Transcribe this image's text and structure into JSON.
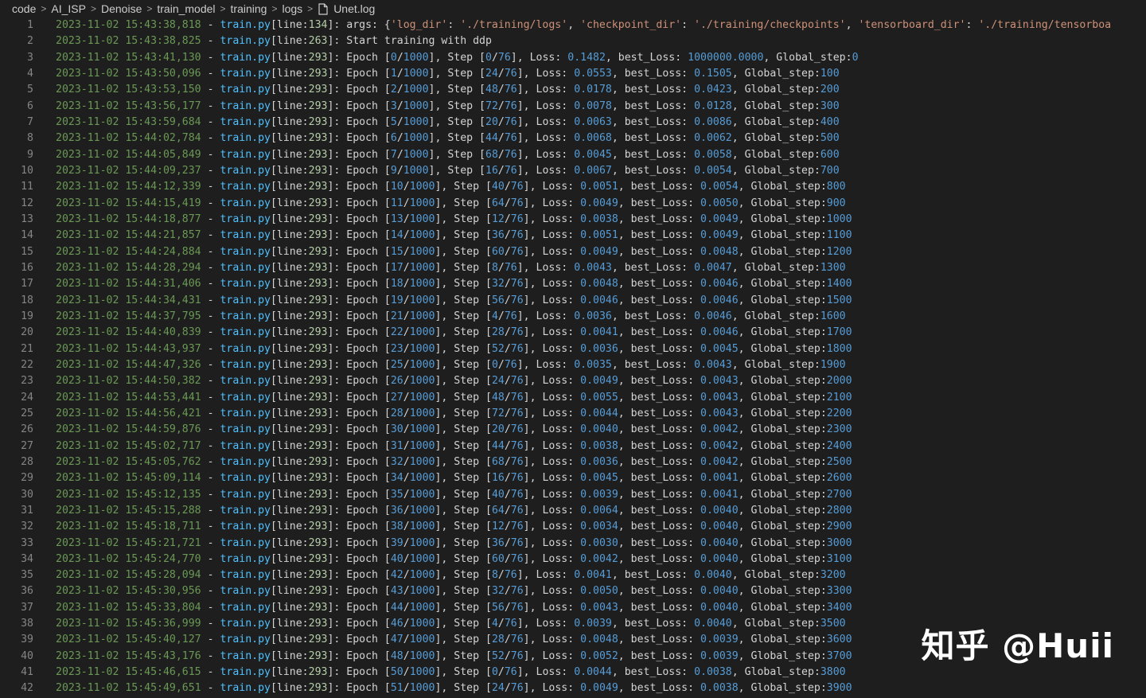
{
  "breadcrumb": [
    "code",
    "AI_ISP",
    "Denoise",
    "train_model",
    "training",
    "logs"
  ],
  "file_name": "Unet.log",
  "watermark": "知乎 @Huii",
  "colors": {
    "timestamp": "#6a9955",
    "file": "#4fc1ff",
    "number": "#569cd6",
    "string": "#ce9178"
  },
  "log": {
    "line1": {
      "ts": "2023-11-02 15:43:38,818",
      "file": "train.py",
      "src_line": "134",
      "args": [
        {
          "key": "'log_dir'",
          "val": "'./training/logs'"
        },
        {
          "key": "'checkpoint_dir'",
          "val": "'./training/checkpoints'"
        },
        {
          "key": "'tensorboard_dir'",
          "val": "'./training/tensorboa"
        }
      ]
    },
    "line2": {
      "ts": "2023-11-02 15:43:38,825",
      "file": "train.py",
      "src_line": "263",
      "message": "Start training with ddp"
    },
    "entries": [
      [
        "2023-11-02 15:43:41,130",
        "0",
        "1000",
        "0",
        "76",
        "0.1482",
        "1000000.0000",
        "0"
      ],
      [
        "2023-11-02 15:43:50,096",
        "1",
        "1000",
        "24",
        "76",
        "0.0553",
        "0.1505",
        "100"
      ],
      [
        "2023-11-02 15:43:53,150",
        "2",
        "1000",
        "48",
        "76",
        "0.0178",
        "0.0423",
        "200"
      ],
      [
        "2023-11-02 15:43:56,177",
        "3",
        "1000",
        "72",
        "76",
        "0.0078",
        "0.0128",
        "300"
      ],
      [
        "2023-11-02 15:43:59,684",
        "5",
        "1000",
        "20",
        "76",
        "0.0063",
        "0.0086",
        "400"
      ],
      [
        "2023-11-02 15:44:02,784",
        "6",
        "1000",
        "44",
        "76",
        "0.0068",
        "0.0062",
        "500"
      ],
      [
        "2023-11-02 15:44:05,849",
        "7",
        "1000",
        "68",
        "76",
        "0.0045",
        "0.0058",
        "600"
      ],
      [
        "2023-11-02 15:44:09,237",
        "9",
        "1000",
        "16",
        "76",
        "0.0067",
        "0.0054",
        "700"
      ],
      [
        "2023-11-02 15:44:12,339",
        "10",
        "1000",
        "40",
        "76",
        "0.0051",
        "0.0054",
        "800"
      ],
      [
        "2023-11-02 15:44:15,419",
        "11",
        "1000",
        "64",
        "76",
        "0.0049",
        "0.0050",
        "900"
      ],
      [
        "2023-11-02 15:44:18,877",
        "13",
        "1000",
        "12",
        "76",
        "0.0038",
        "0.0049",
        "1000"
      ],
      [
        "2023-11-02 15:44:21,857",
        "14",
        "1000",
        "36",
        "76",
        "0.0051",
        "0.0049",
        "1100"
      ],
      [
        "2023-11-02 15:44:24,884",
        "15",
        "1000",
        "60",
        "76",
        "0.0049",
        "0.0048",
        "1200"
      ],
      [
        "2023-11-02 15:44:28,294",
        "17",
        "1000",
        "8",
        "76",
        "0.0043",
        "0.0047",
        "1300"
      ],
      [
        "2023-11-02 15:44:31,406",
        "18",
        "1000",
        "32",
        "76",
        "0.0048",
        "0.0046",
        "1400"
      ],
      [
        "2023-11-02 15:44:34,431",
        "19",
        "1000",
        "56",
        "76",
        "0.0046",
        "0.0046",
        "1500"
      ],
      [
        "2023-11-02 15:44:37,795",
        "21",
        "1000",
        "4",
        "76",
        "0.0036",
        "0.0046",
        "1600"
      ],
      [
        "2023-11-02 15:44:40,839",
        "22",
        "1000",
        "28",
        "76",
        "0.0041",
        "0.0046",
        "1700"
      ],
      [
        "2023-11-02 15:44:43,937",
        "23",
        "1000",
        "52",
        "76",
        "0.0036",
        "0.0045",
        "1800"
      ],
      [
        "2023-11-02 15:44:47,326",
        "25",
        "1000",
        "0",
        "76",
        "0.0035",
        "0.0043",
        "1900"
      ],
      [
        "2023-11-02 15:44:50,382",
        "26",
        "1000",
        "24",
        "76",
        "0.0049",
        "0.0043",
        "2000"
      ],
      [
        "2023-11-02 15:44:53,441",
        "27",
        "1000",
        "48",
        "76",
        "0.0055",
        "0.0043",
        "2100"
      ],
      [
        "2023-11-02 15:44:56,421",
        "28",
        "1000",
        "72",
        "76",
        "0.0044",
        "0.0043",
        "2200"
      ],
      [
        "2023-11-02 15:44:59,876",
        "30",
        "1000",
        "20",
        "76",
        "0.0040",
        "0.0042",
        "2300"
      ],
      [
        "2023-11-02 15:45:02,717",
        "31",
        "1000",
        "44",
        "76",
        "0.0038",
        "0.0042",
        "2400"
      ],
      [
        "2023-11-02 15:45:05,762",
        "32",
        "1000",
        "68",
        "76",
        "0.0036",
        "0.0042",
        "2500"
      ],
      [
        "2023-11-02 15:45:09,114",
        "34",
        "1000",
        "16",
        "76",
        "0.0045",
        "0.0041",
        "2600"
      ],
      [
        "2023-11-02 15:45:12,135",
        "35",
        "1000",
        "40",
        "76",
        "0.0039",
        "0.0041",
        "2700"
      ],
      [
        "2023-11-02 15:45:15,288",
        "36",
        "1000",
        "64",
        "76",
        "0.0064",
        "0.0040",
        "2800"
      ],
      [
        "2023-11-02 15:45:18,711",
        "38",
        "1000",
        "12",
        "76",
        "0.0034",
        "0.0040",
        "2900"
      ],
      [
        "2023-11-02 15:45:21,721",
        "39",
        "1000",
        "36",
        "76",
        "0.0030",
        "0.0040",
        "3000"
      ],
      [
        "2023-11-02 15:45:24,770",
        "40",
        "1000",
        "60",
        "76",
        "0.0042",
        "0.0040",
        "3100"
      ],
      [
        "2023-11-02 15:45:28,094",
        "42",
        "1000",
        "8",
        "76",
        "0.0041",
        "0.0040",
        "3200"
      ],
      [
        "2023-11-02 15:45:30,956",
        "43",
        "1000",
        "32",
        "76",
        "0.0050",
        "0.0040",
        "3300"
      ],
      [
        "2023-11-02 15:45:33,804",
        "44",
        "1000",
        "56",
        "76",
        "0.0043",
        "0.0040",
        "3400"
      ],
      [
        "2023-11-02 15:45:36,999",
        "46",
        "1000",
        "4",
        "76",
        "0.0039",
        "0.0040",
        "3500"
      ],
      [
        "2023-11-02 15:45:40,127",
        "47",
        "1000",
        "28",
        "76",
        "0.0048",
        "0.0039",
        "3600"
      ],
      [
        "2023-11-02 15:45:43,176",
        "48",
        "1000",
        "52",
        "76",
        "0.0052",
        "0.0039",
        "3700"
      ],
      [
        "2023-11-02 15:45:46,615",
        "50",
        "1000",
        "0",
        "76",
        "0.0044",
        "0.0038",
        "3800"
      ],
      [
        "2023-11-02 15:45:49,651",
        "51",
        "1000",
        "24",
        "76",
        "0.0049",
        "0.0038",
        "3900"
      ]
    ],
    "entry_file": "train.py",
    "entry_src_line": "293"
  }
}
